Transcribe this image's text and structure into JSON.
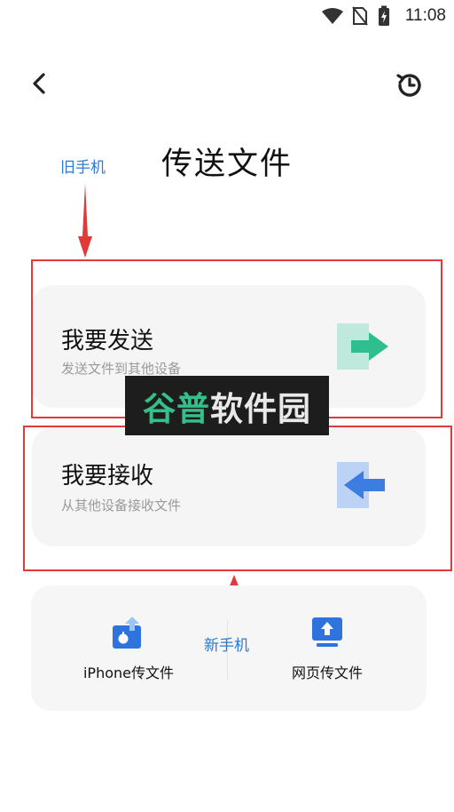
{
  "status_bar": {
    "time": "11:08",
    "icons": [
      "wifi-icon",
      "no-sim-icon",
      "battery-charging-icon"
    ]
  },
  "header": {
    "back_icon": "chevron-left-icon",
    "history_icon": "history-icon",
    "title": "传送文件"
  },
  "annotations": {
    "old_phone": "旧手机",
    "new_phone": "新手机",
    "highlight_color": "#e03a3a",
    "annotation_color": "#2b7ad6"
  },
  "send_card": {
    "title": "我要发送",
    "subtitle": "发送文件到其他设备",
    "icon": "send-arrow-icon",
    "accent": "#2fbf8f"
  },
  "receive_card": {
    "title": "我要接收",
    "subtitle": "从其他设备接收文件",
    "icon": "receive-arrow-icon",
    "accent": "#3b7de0"
  },
  "bottom_actions": {
    "iphone_label": "iPhone传文件",
    "iphone_icon": "iphone-transfer-icon",
    "web_label": "网页传文件",
    "web_icon": "web-upload-icon"
  },
  "watermark": {
    "part1": "谷普",
    "part2": "软件园"
  }
}
